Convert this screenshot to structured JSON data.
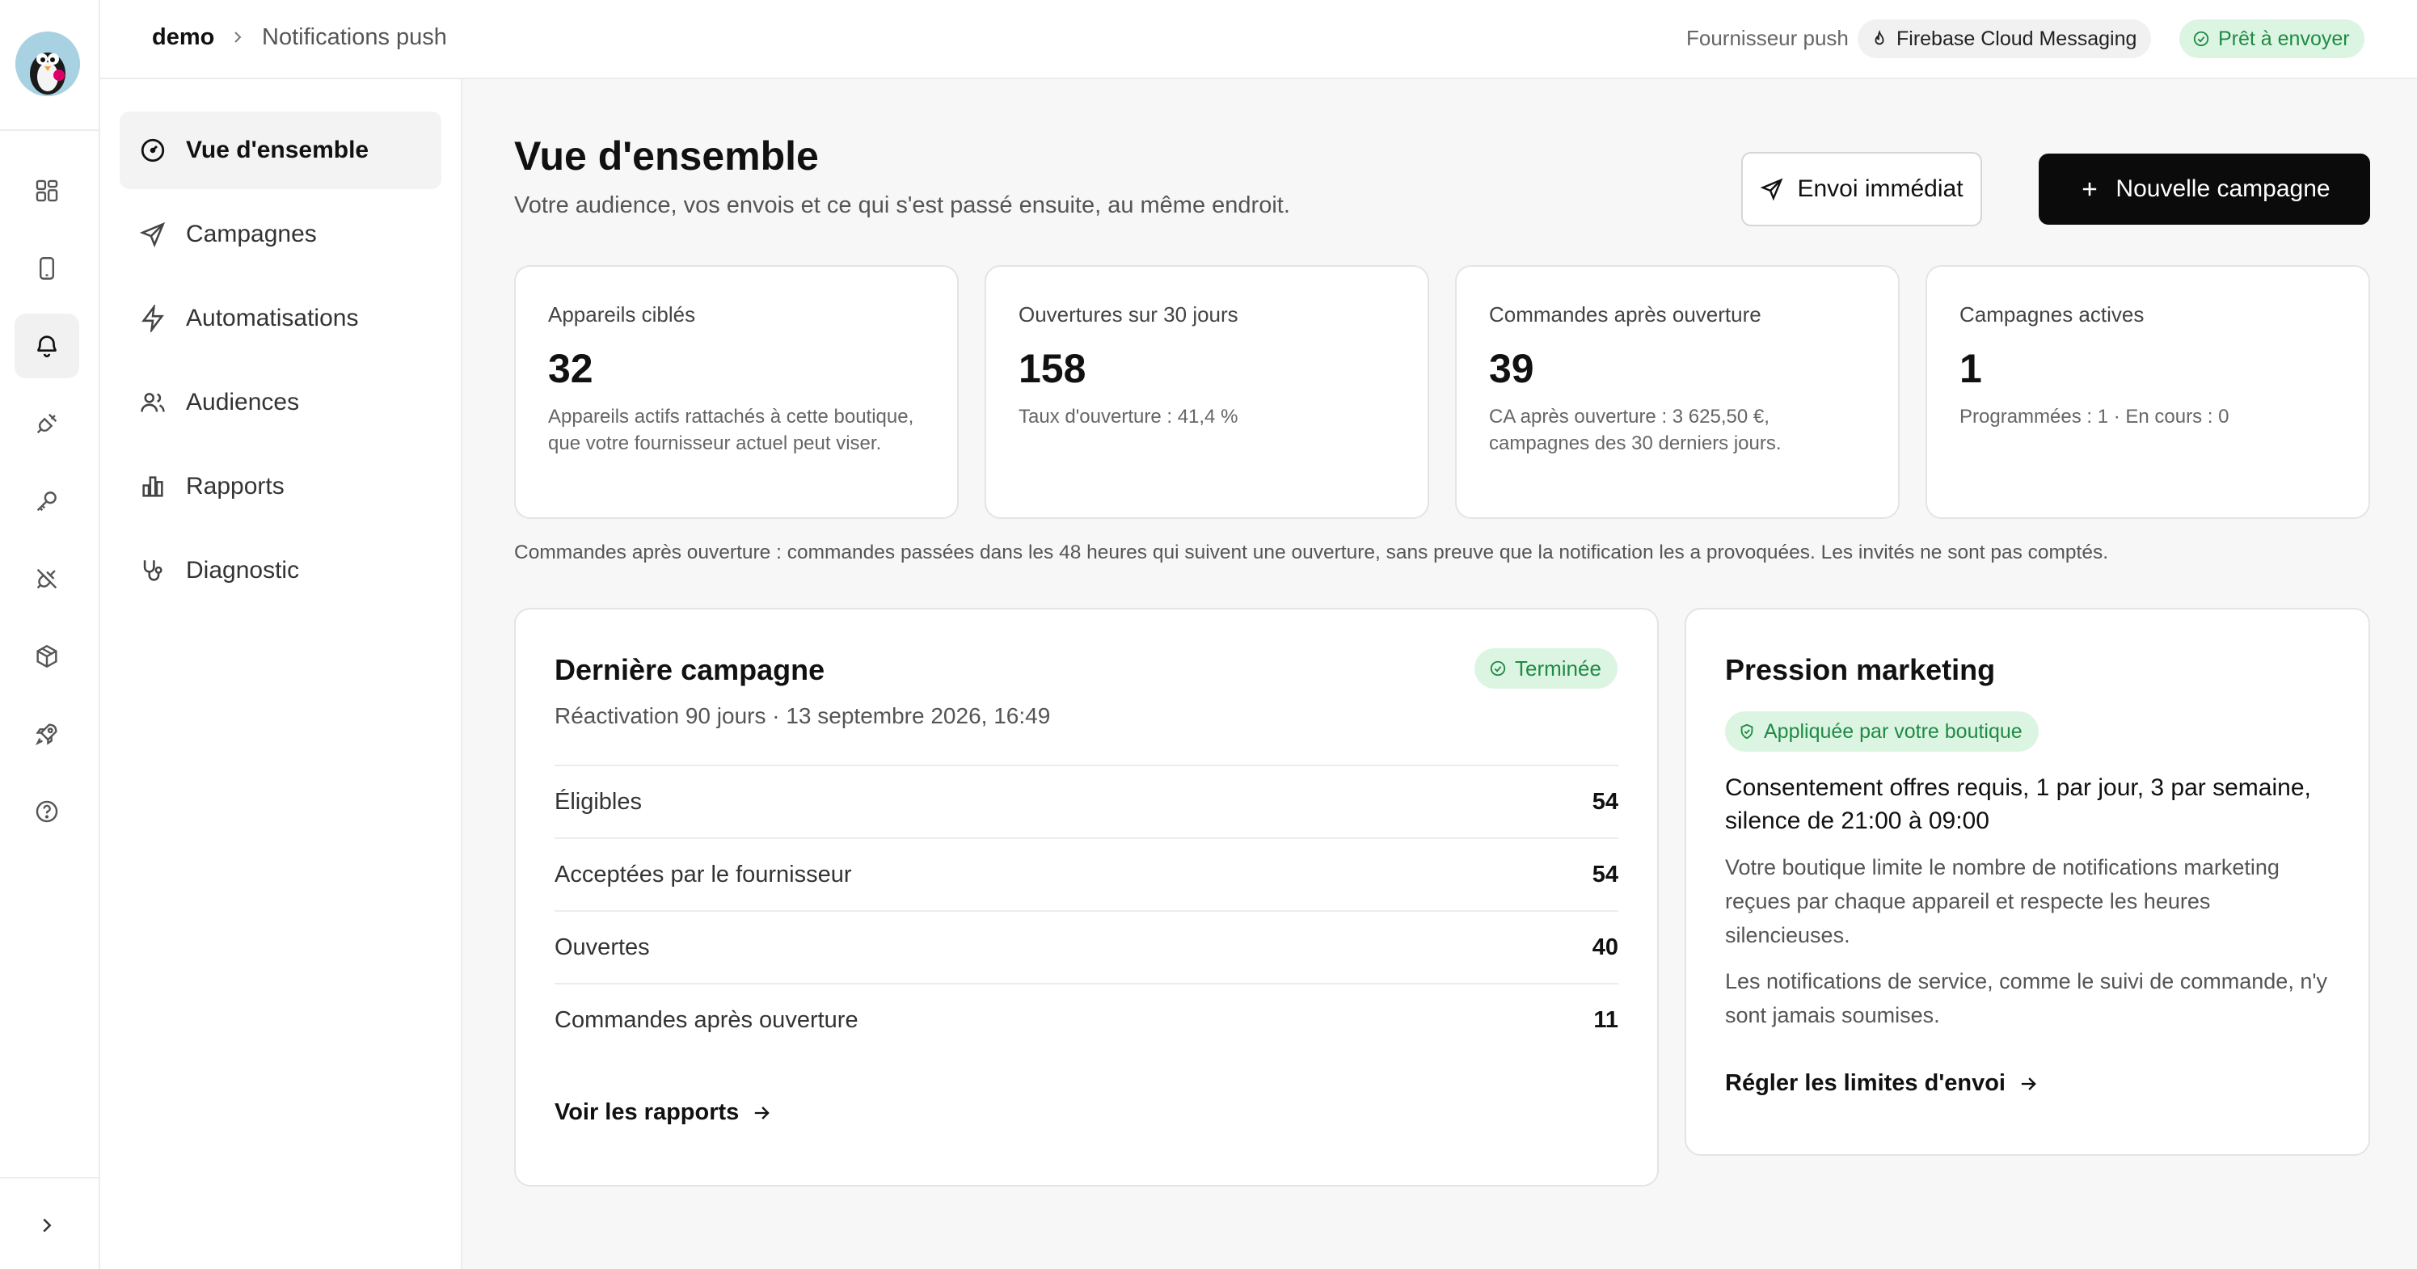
{
  "rail": {
    "logo": "prestashop-logo",
    "items": [
      {
        "icon": "dashboard-icon",
        "active": false
      },
      {
        "icon": "smartphone-icon",
        "active": false
      },
      {
        "icon": "bell-icon",
        "active": true
      },
      {
        "icon": "plug-icon",
        "active": false
      },
      {
        "icon": "key-icon",
        "active": false
      },
      {
        "icon": "plug-off-icon",
        "active": false
      },
      {
        "icon": "package-icon",
        "active": false
      },
      {
        "icon": "rocket-icon",
        "active": false
      },
      {
        "icon": "help-icon",
        "active": false
      }
    ],
    "collapse_icon": "chevron-right-icon"
  },
  "topbar": {
    "breadcrumb_root": "demo",
    "breadcrumb_current": "Notifications push",
    "provider_label": "Fournisseur push",
    "provider_name": "Firebase Cloud Messaging",
    "status": "Prêt à envoyer"
  },
  "nav": [
    {
      "label": "Vue d'ensemble",
      "icon": "gauge-icon",
      "active": true
    },
    {
      "label": "Campagnes",
      "icon": "send-icon",
      "active": false
    },
    {
      "label": "Automatisations",
      "icon": "zap-icon",
      "active": false
    },
    {
      "label": "Audiences",
      "icon": "users-icon",
      "active": false
    },
    {
      "label": "Rapports",
      "icon": "bar-chart-icon",
      "active": false
    },
    {
      "label": "Diagnostic",
      "icon": "stethoscope-icon",
      "active": false
    }
  ],
  "header": {
    "title": "Vue d'ensemble",
    "subtitle": "Votre audience, vos envois et ce qui s'est passé ensuite, au même endroit.",
    "send_now_label": "Envoi immédiat",
    "new_campaign_label": "Nouvelle campagne"
  },
  "stats": [
    {
      "label": "Appareils ciblés",
      "value": "32",
      "note": "Appareils actifs rattachés à cette boutique, que votre fournisseur actuel peut viser."
    },
    {
      "label": "Ouvertures sur 30 jours",
      "value": "158",
      "note": "Taux d'ouverture : 41,4 %"
    },
    {
      "label": "Commandes après ouverture",
      "value": "39",
      "note": "CA après ouverture : 3 625,50 €, campagnes des 30 derniers jours."
    },
    {
      "label": "Campagnes actives",
      "value": "1",
      "note": "Programmées : 1 · En cours : 0"
    }
  ],
  "footnote": "Commandes après ouverture : commandes passées dans les 48 heures qui suivent une ouverture, sans preuve que la notification les a provoquées. Les invités ne sont pas comptés.",
  "last_campaign": {
    "title": "Dernière campagne",
    "status": "Terminée",
    "subtitle": "Réactivation 90 jours · 13 septembre 2026, 16:49",
    "rows": [
      {
        "label": "Éligibles",
        "value": "54"
      },
      {
        "label": "Acceptées par le fournisseur",
        "value": "54"
      },
      {
        "label": "Ouvertes",
        "value": "40"
      },
      {
        "label": "Commandes après ouverture",
        "value": "11"
      }
    ],
    "link": "Voir les rapports"
  },
  "pressure": {
    "title": "Pression marketing",
    "badge": "Appliquée par votre boutique",
    "summary": "Consentement offres requis, 1 par jour, 3 par semaine, silence de 21:00 à 09:00",
    "text1": "Votre boutique limite le nombre de notifications marketing reçues par chaque appareil et respecte les heures silencieuses.",
    "text2": "Les notifications de service, comme le suivi de commande, n'y sont jamais soumises.",
    "link": "Régler les limites d'envoi"
  },
  "colors": {
    "accent": "#0b0b0b",
    "success_bg": "#dcf5e3",
    "success_text": "#1f8a44"
  }
}
